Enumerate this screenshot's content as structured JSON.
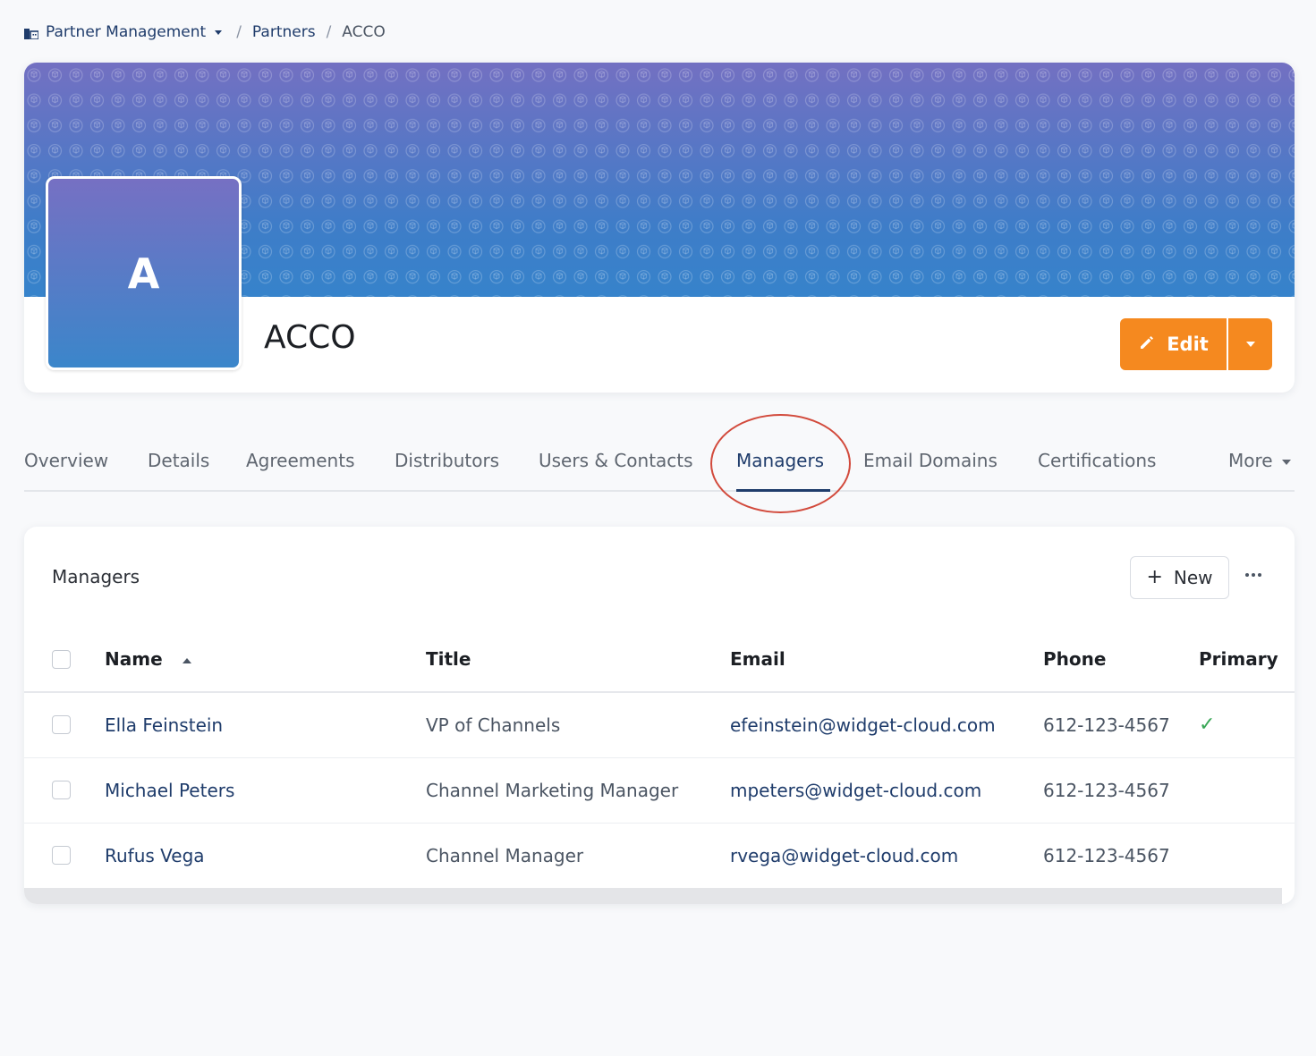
{
  "breadcrumb": {
    "root": "Partner Management",
    "parent": "Partners",
    "current": "ACCO"
  },
  "partner": {
    "avatar_letter": "A",
    "name": "ACCO"
  },
  "actions": {
    "edit_label": "Edit"
  },
  "tabs": [
    {
      "label": "Overview"
    },
    {
      "label": "Details"
    },
    {
      "label": "Agreements"
    },
    {
      "label": "Distributors"
    },
    {
      "label": "Users & Contacts"
    },
    {
      "label": "Managers",
      "active": true
    },
    {
      "label": "Email Domains"
    },
    {
      "label": "Certifications"
    },
    {
      "label": "More"
    }
  ],
  "managers": {
    "title": "Managers",
    "new_label": "New",
    "columns": {
      "name": "Name",
      "title": "Title",
      "email": "Email",
      "phone": "Phone",
      "primary": "Primary"
    },
    "rows": [
      {
        "name": "Ella Feinstein",
        "title": "VP of Channels",
        "email": "efeinstein@widget-cloud.com",
        "phone": "612-123-4567",
        "primary": true
      },
      {
        "name": "Michael Peters",
        "title": "Channel Marketing Manager",
        "email": "mpeters@widget-cloud.com",
        "phone": "612-123-4567",
        "primary": false
      },
      {
        "name": "Rufus Vega",
        "title": "Channel Manager",
        "email": "rvega@widget-cloud.com",
        "phone": "612-123-4567",
        "primary": false
      }
    ]
  },
  "colors": {
    "accent_orange": "#f5891f",
    "link_navy": "#1f3c6b",
    "highlight_red": "#d24a3c",
    "check_green": "#3aa757"
  },
  "icons": {
    "breadcrumb": "building-icon",
    "edit": "pencil-icon",
    "primary": "checkmark-icon"
  }
}
